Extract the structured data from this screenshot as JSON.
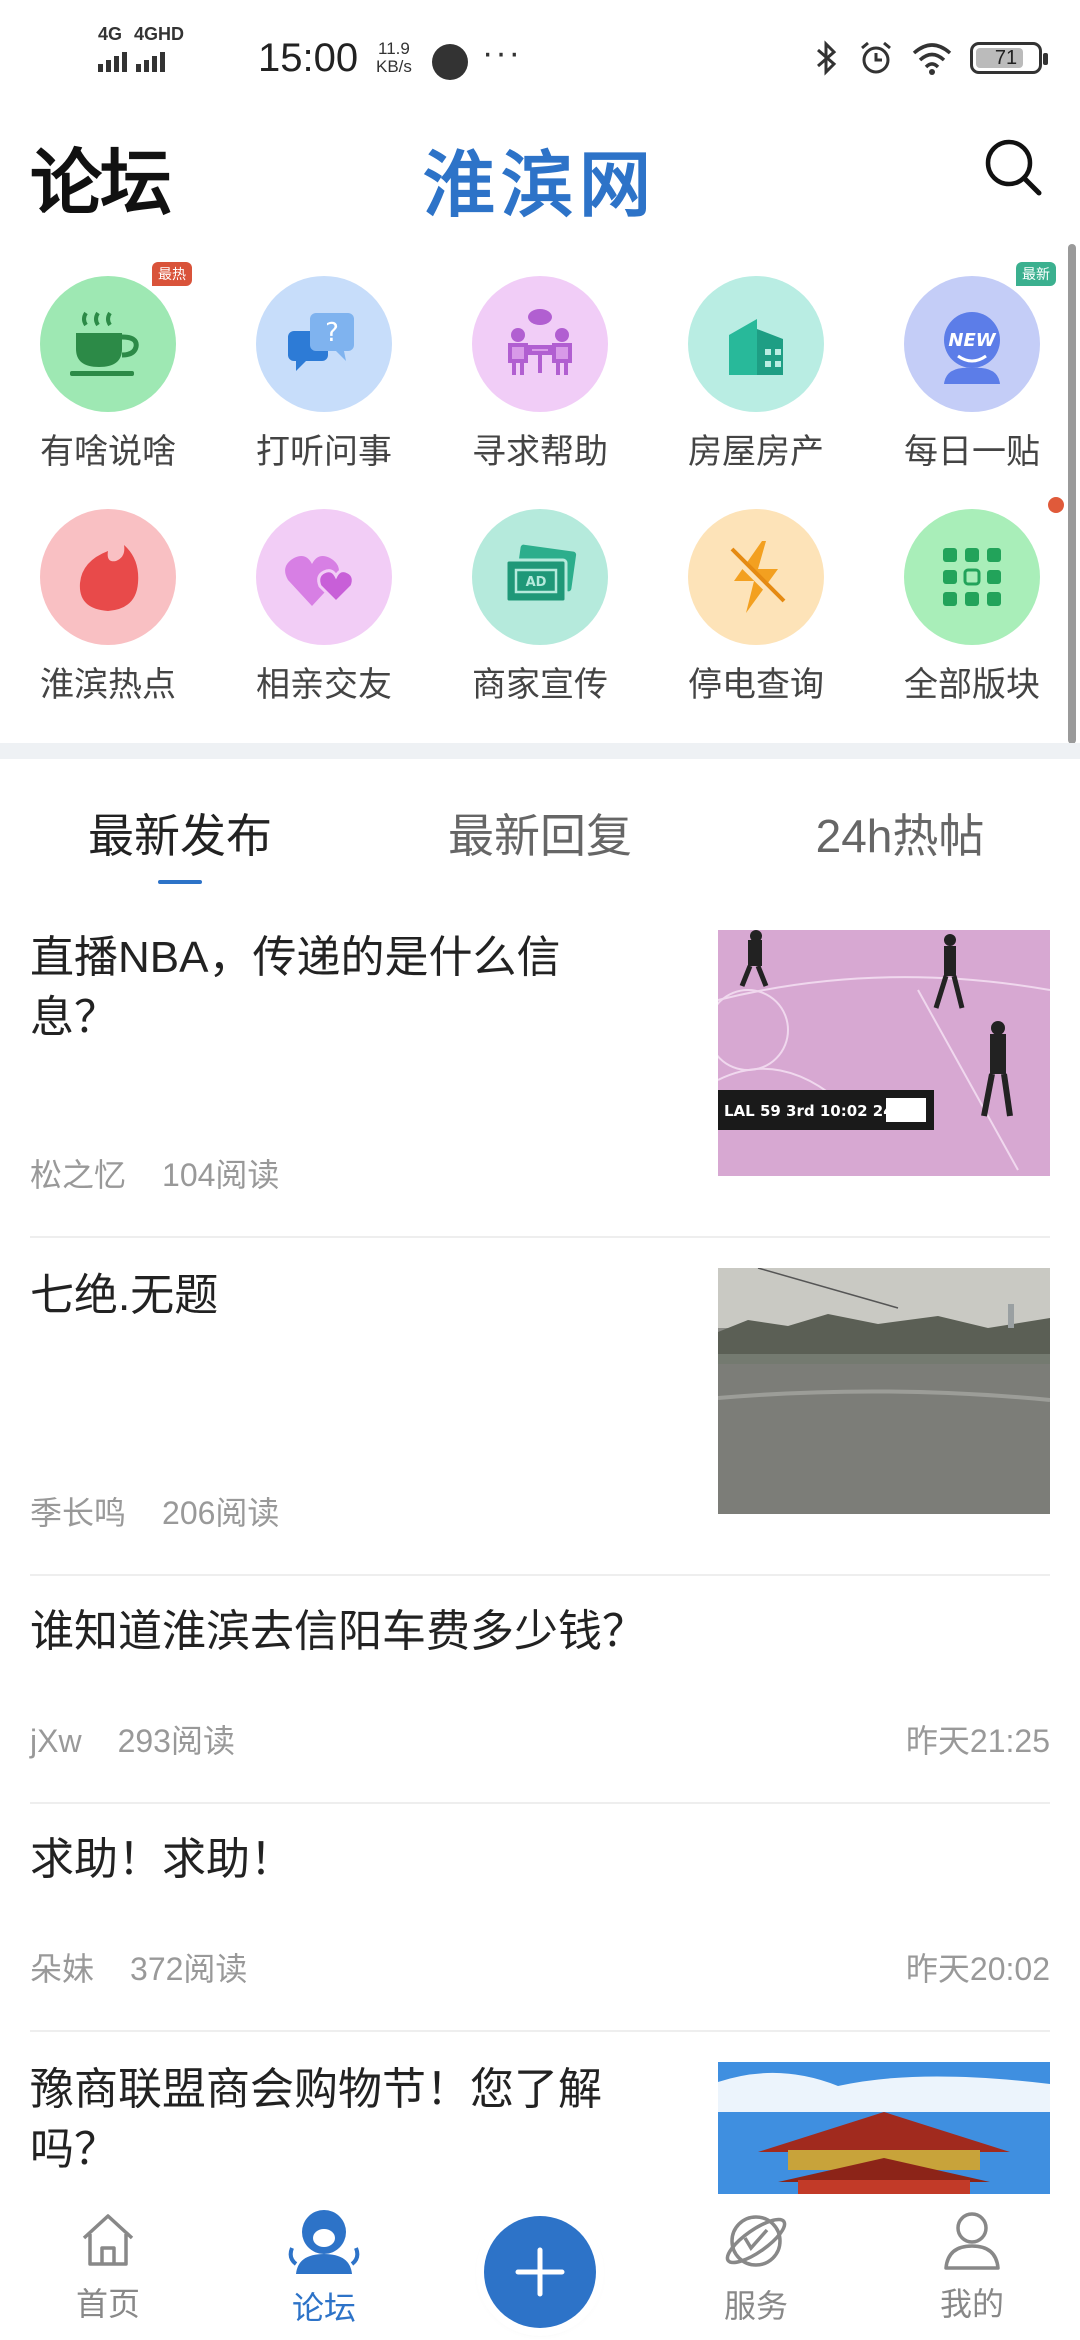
{
  "status_bar": {
    "net1": "4G",
    "net2": "4GHD",
    "time": "15:00",
    "speed_value": "11.9",
    "speed_unit": "KB/s",
    "dots": "···",
    "battery": "71"
  },
  "header": {
    "left_title": "论坛",
    "center_title": "淮滨网"
  },
  "grid": {
    "row1": [
      {
        "label": "有啥说啥",
        "badge": "最热",
        "color": "#9ee8b3"
      },
      {
        "label": "打听问事",
        "color": "#c7ddfa"
      },
      {
        "label": "寻求帮助",
        "color": "#f1cdf7"
      },
      {
        "label": "房屋房产",
        "color": "#b9ede3"
      },
      {
        "label": "每日一贴",
        "badge": "最新",
        "color": "#c4cdf7"
      }
    ],
    "row2": [
      {
        "label": "淮滨热点",
        "color": "#f9c0c3"
      },
      {
        "label": "相亲交友",
        "color": "#f2cdf6"
      },
      {
        "label": "商家宣传",
        "color": "#b5eadc"
      },
      {
        "label": "停电查询",
        "color": "#fde3b8"
      },
      {
        "label": "全部版块",
        "color": "#a9eeb9"
      }
    ]
  },
  "tabs": [
    "最新发布",
    "最新回复",
    "24h热帖"
  ],
  "posts": [
    {
      "title": "直播NBA，传递的是什么信息？",
      "author": "松之忆",
      "reads": "104阅读",
      "score_text": "LAL 59  3rd 10:02 24"
    },
    {
      "title": "七绝.无题",
      "author": "季长鸣",
      "reads": "206阅读"
    },
    {
      "title": "谁知道淮滨去信阳车费多少钱？",
      "author": "jXw",
      "reads": "293阅读",
      "time": "昨天21:25"
    },
    {
      "title": "求助！求助！",
      "author": "朵妹",
      "reads": "372阅读",
      "time": "昨天20:02"
    },
    {
      "title": "豫商联盟商会购物节！您了解吗？"
    }
  ],
  "bottom_nav": {
    "home": "首页",
    "forum": "论坛",
    "service": "服务",
    "mine": "我的"
  },
  "accent_color": "#2d73c8"
}
